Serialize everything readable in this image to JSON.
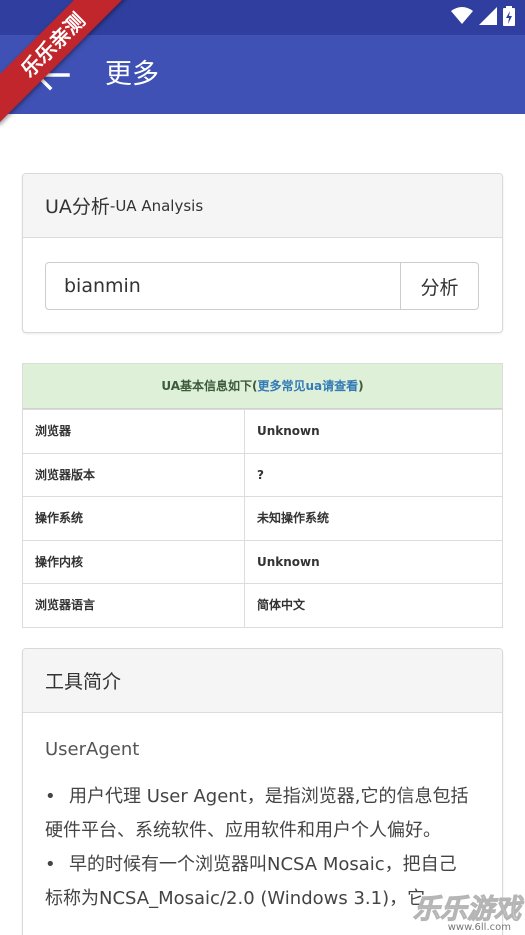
{
  "app_bar": {
    "title": "更多"
  },
  "ribbon": {
    "text": "乐乐亲测"
  },
  "ua_panel": {
    "title": "UA分析",
    "subtitle": "-UA Analysis",
    "input_value": "bianmin",
    "button_label": "分析"
  },
  "info_table": {
    "caption_prefix": "UA基本信息如下(",
    "caption_link": "更多常见ua请查看",
    "caption_suffix": ")",
    "rows": [
      {
        "label": "浏览器",
        "value": "Unknown"
      },
      {
        "label": "浏览器版本",
        "value": "?"
      },
      {
        "label": "操作系统",
        "value": "未知操作系统"
      },
      {
        "label": "操作内核",
        "value": "Unknown"
      },
      {
        "label": "浏览器语言",
        "value": "简体中文"
      }
    ]
  },
  "tool_panel": {
    "title": "工具简介",
    "heading": "UserAgent",
    "bullets": [
      {
        "line1": "用户代理 User Agent，是指浏览器,它的信息包括",
        "line2": "硬件平台、系统软件、应用软件和用户个人偏好。"
      },
      {
        "line1": "早的时候有一个浏览器叫NCSA Mosaic，把自己",
        "line2": "标称为NCSA_Mosaic/2.0 (Windows 3.1)，它"
      }
    ]
  },
  "watermark": {
    "text": "乐乐游戏",
    "url": "www.6ll.com"
  },
  "colors": {
    "status_bar": "#303f9f",
    "app_bar": "#3f51b5",
    "table_caption_bg": "#dff0d8",
    "ribbon": "#c0262b",
    "link": "#337ab7"
  },
  "icons": {
    "back": "arrow-left-icon",
    "wifi": "wifi-icon",
    "signal": "signal-icon",
    "battery": "battery-icon"
  }
}
